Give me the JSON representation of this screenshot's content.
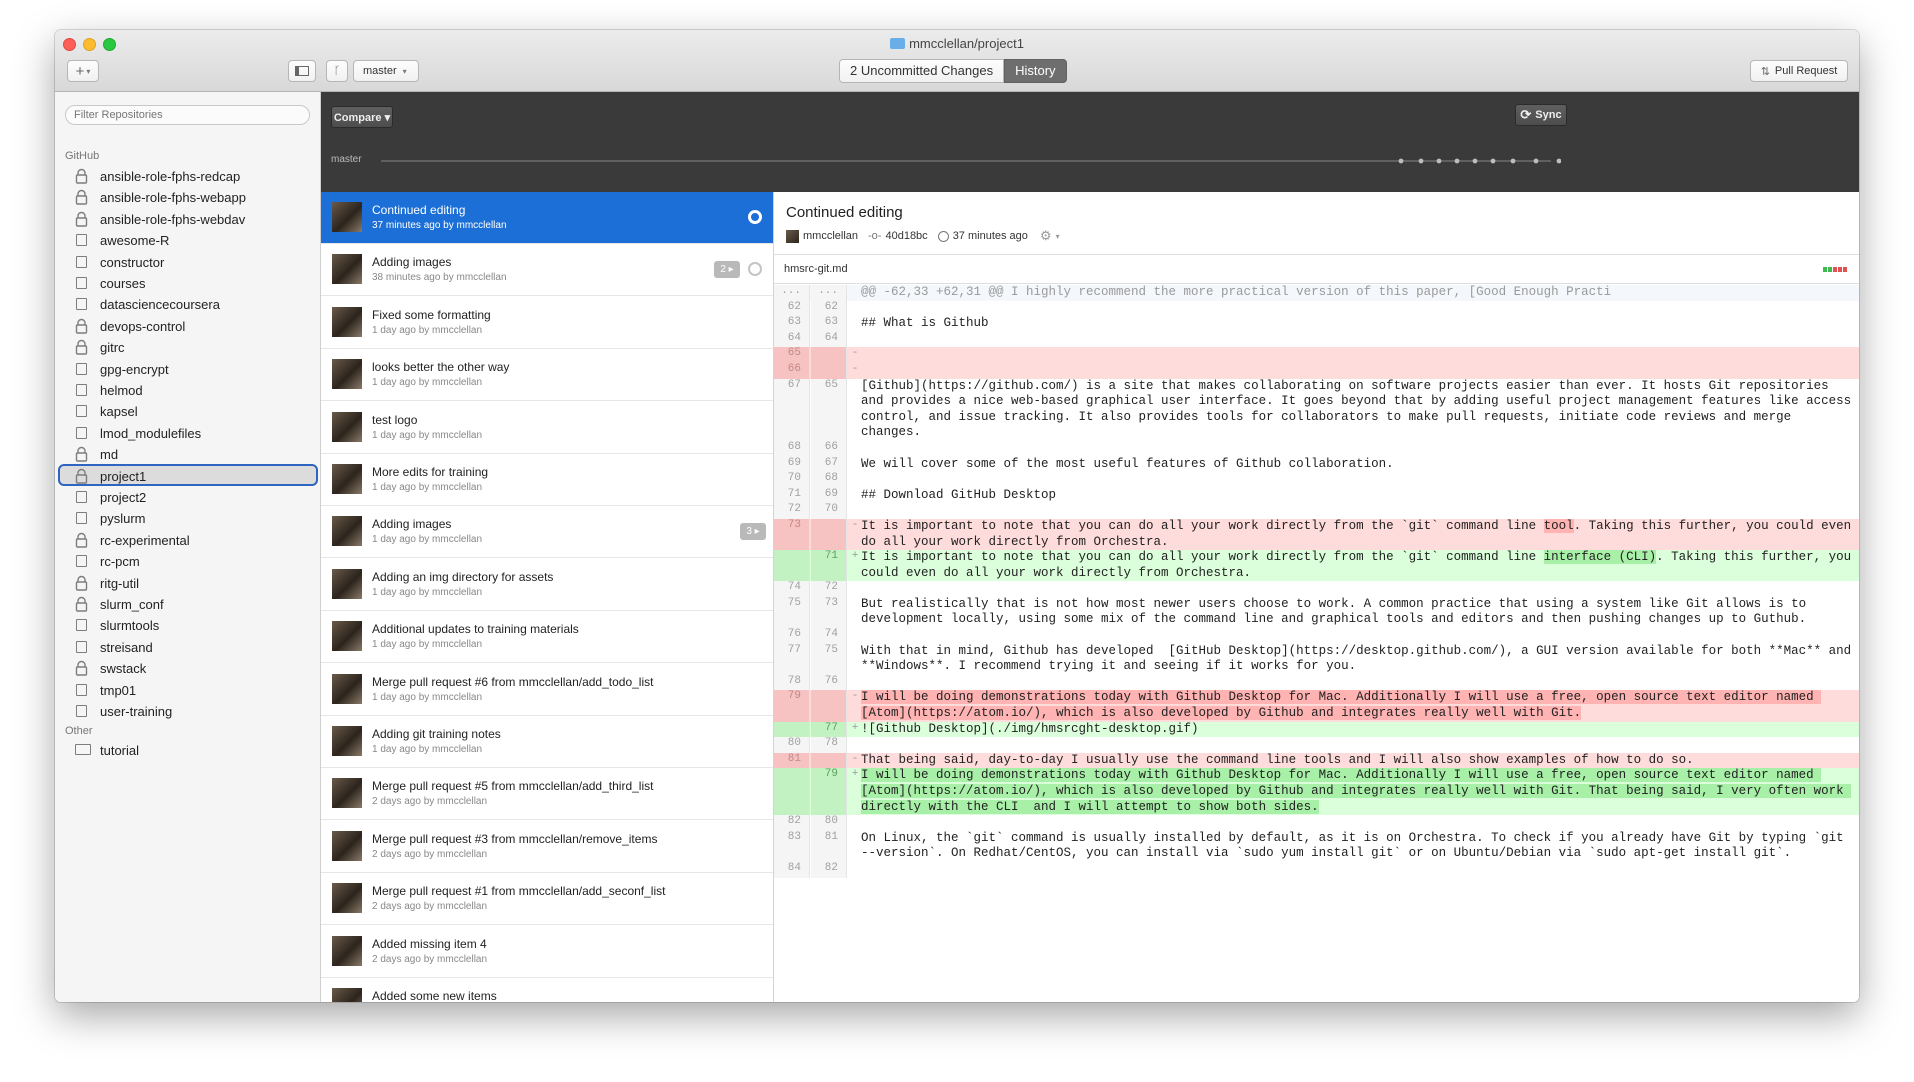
{
  "window": {
    "title": "mmcclellan/project1"
  },
  "toolbar": {
    "add_label": "+",
    "branch": "master",
    "tab_uncommitted": "2 Uncommitted Changes",
    "tab_history": "History",
    "pull_request": "Pull Request"
  },
  "sidebar": {
    "filter_placeholder": "Filter Repositories",
    "github_label": "GitHub",
    "other_label": "Other",
    "repos": [
      {
        "name": "ansible-role-fphs-redcap",
        "icon": "lock"
      },
      {
        "name": "ansible-role-fphs-webapp",
        "icon": "lock"
      },
      {
        "name": "ansible-role-fphs-webdav",
        "icon": "lock"
      },
      {
        "name": "awesome-R",
        "icon": "repo"
      },
      {
        "name": "constructor",
        "icon": "repo"
      },
      {
        "name": "courses",
        "icon": "repo"
      },
      {
        "name": "datasciencecoursera",
        "icon": "repo"
      },
      {
        "name": "devops-control",
        "icon": "lock"
      },
      {
        "name": "gitrc",
        "icon": "lock"
      },
      {
        "name": "gpg-encrypt",
        "icon": "repo"
      },
      {
        "name": "helmod",
        "icon": "repo"
      },
      {
        "name": "kapsel",
        "icon": "repo"
      },
      {
        "name": "lmod_modulefiles",
        "icon": "repo"
      },
      {
        "name": "md",
        "icon": "lock"
      },
      {
        "name": "project1",
        "icon": "lock"
      },
      {
        "name": "project2",
        "icon": "repo"
      },
      {
        "name": "pyslurm",
        "icon": "repo"
      },
      {
        "name": "rc-experimental",
        "icon": "lock"
      },
      {
        "name": "rc-pcm",
        "icon": "repo"
      },
      {
        "name": "ritg-util",
        "icon": "lock"
      },
      {
        "name": "slurm_conf",
        "icon": "lock"
      },
      {
        "name": "slurmtools",
        "icon": "repo"
      },
      {
        "name": "streisand",
        "icon": "repo"
      },
      {
        "name": "swstack",
        "icon": "lock"
      },
      {
        "name": "tmp01",
        "icon": "repo"
      },
      {
        "name": "user-training",
        "icon": "repo"
      }
    ],
    "selected": "project1",
    "other": [
      {
        "name": "tutorial",
        "icon": "monitor"
      }
    ]
  },
  "history_bar": {
    "compare_label": "Compare ▾",
    "sync_label": "Sync",
    "branch_label": "master"
  },
  "commits": [
    {
      "title": "Continued editing",
      "sub": "37 minutes ago by mmcclellan",
      "selected": true
    },
    {
      "title": "Adding images",
      "sub": "38 minutes ago by mmcclellan",
      "badge": "2 ▸"
    },
    {
      "title": "Fixed some formatting",
      "sub": "1 day ago by mmcclellan"
    },
    {
      "title": "looks better the other way",
      "sub": "1 day ago by mmcclellan"
    },
    {
      "title": "test logo",
      "sub": "1 day ago by mmcclellan"
    },
    {
      "title": "More edits for training",
      "sub": "1 day ago by mmcclellan"
    },
    {
      "title": "Adding images",
      "sub": "1 day ago by mmcclellan",
      "badge": "3 ▸"
    },
    {
      "title": "Adding an img directory for assets",
      "sub": "1 day ago by mmcclellan"
    },
    {
      "title": "Additional updates to training materials",
      "sub": "1 day ago by mmcclellan"
    },
    {
      "title": "Merge pull request #6 from mmcclellan/add_todo_list",
      "sub": "1 day ago by mmcclellan"
    },
    {
      "title": "Adding git training notes",
      "sub": "1 day ago by mmcclellan"
    },
    {
      "title": "Merge pull request #5 from mmcclellan/add_third_list",
      "sub": "2 days ago by mmcclellan"
    },
    {
      "title": "Merge pull request #3 from mmcclellan/remove_items",
      "sub": "2 days ago by mmcclellan"
    },
    {
      "title": "Merge pull request #1 from mmcclellan/add_seconf_list",
      "sub": "2 days ago by mmcclellan"
    },
    {
      "title": "Added missing item 4",
      "sub": "2 days ago by mmcclellan"
    },
    {
      "title": "Added some new items",
      "sub": ""
    }
  ],
  "detail": {
    "title": "Continued editing",
    "author": "mmcclellan",
    "sha": "40d18bc",
    "time": "37 minutes ago",
    "file": "hmsrc-git.md"
  },
  "diff": [
    {
      "type": "hunk",
      "o": "...",
      "n": "...",
      "t": "@@ -62,33 +62,31 @@ I highly recommend the more practical version of this paper, [Good Enough Practi"
    },
    {
      "type": "ctx",
      "o": "62",
      "n": "62",
      "t": ""
    },
    {
      "type": "ctx",
      "o": "63",
      "n": "63",
      "t": "## What is Github"
    },
    {
      "type": "ctx",
      "o": "64",
      "n": "64",
      "t": ""
    },
    {
      "type": "del",
      "o": "65",
      "n": "",
      "t": ""
    },
    {
      "type": "del",
      "o": "66",
      "n": "",
      "t": ""
    },
    {
      "type": "ctx",
      "o": "67",
      "n": "65",
      "t": "[Github](https://github.com/) is a site that makes collaborating on software projects easier than ever. It hosts Git repositories and provides a nice web-based graphical user interface. It goes beyond that by adding useful project management features like access control, and issue tracking. It also provides tools for collaborators to make pull requests, initiate code reviews and merge changes."
    },
    {
      "type": "ctx",
      "o": "68",
      "n": "66",
      "t": ""
    },
    {
      "type": "ctx",
      "o": "69",
      "n": "67",
      "t": "We will cover some of the most useful features of Github collaboration."
    },
    {
      "type": "ctx",
      "o": "70",
      "n": "68",
      "t": ""
    },
    {
      "type": "ctx",
      "o": "71",
      "n": "69",
      "t": "## Download GitHub Desktop"
    },
    {
      "type": "ctx",
      "o": "72",
      "n": "70",
      "t": ""
    },
    {
      "type": "del",
      "o": "73",
      "n": "",
      "t": "It is important to note that you can do all your work directly from the `git` command line ",
      "hl": "tool",
      "t2": ". Taking this further, you could even do all your work directly from Orchestra."
    },
    {
      "type": "add",
      "o": "",
      "n": "71",
      "t": "It is important to note that you can do all your work directly from the `git` command line ",
      "hl": "interface (CLI)",
      "t2": ". Taking this further, you could even do all your work directly from Orchestra."
    },
    {
      "type": "ctx",
      "o": "74",
      "n": "72",
      "t": ""
    },
    {
      "type": "ctx",
      "o": "75",
      "n": "73",
      "t": "But realistically that is not how most newer users choose to work. A common practice that using a system like Git allows is to development locally, using some mix of the command line and graphical tools and editors and then pushing changes up to Guthub."
    },
    {
      "type": "ctx",
      "o": "76",
      "n": "74",
      "t": ""
    },
    {
      "type": "ctx",
      "o": "77",
      "n": "75",
      "t": "With that in mind, Github has developed  [GitHub Desktop](https://desktop.github.com/), a GUI version available for both **Mac** and **Windows**. I recommend trying it and seeing if it works for you."
    },
    {
      "type": "ctx",
      "o": "78",
      "n": "76",
      "t": ""
    },
    {
      "type": "del",
      "o": "79",
      "n": "",
      "t": "",
      "hl": "I will be doing demonstrations today with Github Desktop for Mac. Additionally I will use a free, open source text editor named [Atom](https://atom.io/), which is also developed by Github and integrates really well with Git.",
      "t2": ""
    },
    {
      "type": "add",
      "o": "",
      "n": "77",
      "t": "![Github Desktop](./img/hmsrcght-desktop.gif)"
    },
    {
      "type": "ctx",
      "o": "80",
      "n": "78",
      "t": ""
    },
    {
      "type": "del",
      "o": "81",
      "n": "",
      "t": "That being said, day-to-day I usually use the command line tools and I will also show examples of how to do so."
    },
    {
      "type": "add",
      "o": "",
      "n": "79",
      "t": "",
      "hl": "I will be doing demonstrations today with Github Desktop for Mac. Additionally I will use a free, open source text editor named [Atom](https://atom.io/), which is also developed by Github and integrates really well with Git. That being said, I very often work directly with the CLI  and I will attempt to show both sides.",
      "t2": ""
    },
    {
      "type": "ctx",
      "o": "82",
      "n": "80",
      "t": ""
    },
    {
      "type": "ctx",
      "o": "83",
      "n": "81",
      "t": "On Linux, the `git` command is usually installed by default, as it is on Orchestra. To check if you already have Git by typing `git --version`. On Redhat/CentOS, you can install via `sudo yum install git` or on Ubuntu/Debian via `sudo apt-get install git`."
    },
    {
      "type": "ctx",
      "o": "84",
      "n": "82",
      "t": ""
    }
  ],
  "colors": {
    "selection": "#1c6fd6",
    "del_bg": "#ffdcdc",
    "add_bg": "#dbffdb",
    "dark_bar": "#3a3a3a"
  }
}
